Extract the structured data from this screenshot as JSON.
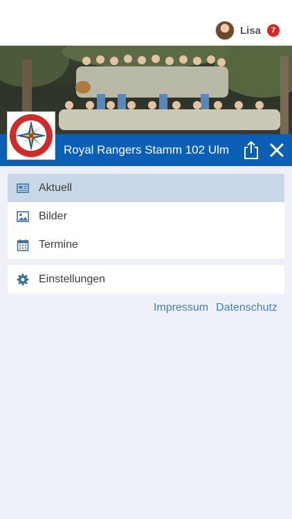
{
  "user": {
    "name": "Lisa",
    "notification_count": "7"
  },
  "group": {
    "title": "Royal Rangers Stamm 102 Ulm",
    "logo_alt": "Royal Rangers"
  },
  "menu": {
    "items": [
      {
        "label": "Aktuell",
        "icon": "newspaper-icon",
        "active": true
      },
      {
        "label": "Bilder",
        "icon": "image-icon",
        "active": false
      },
      {
        "label": "Termine",
        "icon": "calendar-icon",
        "active": false
      }
    ],
    "settings": {
      "label": "Einstellungen",
      "icon": "gear-icon"
    }
  },
  "footer": {
    "impressum": "Impressum",
    "datenschutz": "Datenschutz"
  },
  "colors": {
    "brand": "#0b5fb5",
    "active_item": "#c9d8e9",
    "badge": "#e02424",
    "link": "#4a7db0",
    "icon": "#3d6f9f",
    "background": "#eef2f8"
  }
}
